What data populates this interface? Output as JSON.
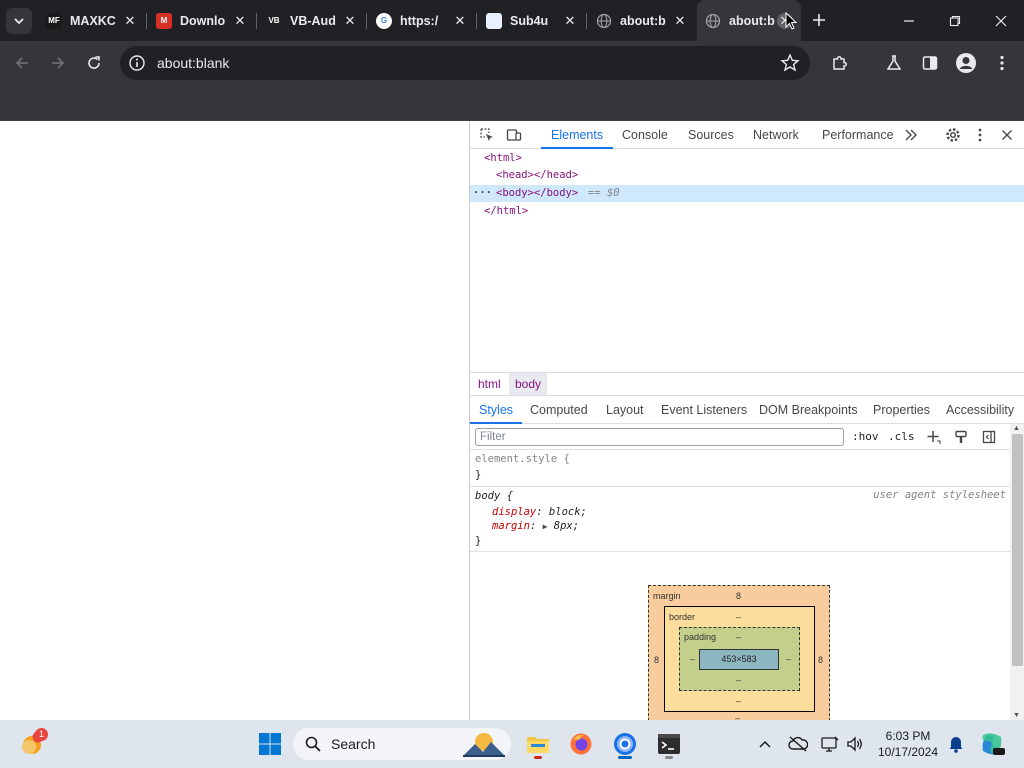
{
  "tabs": [
    {
      "title": "MAXKC",
      "favicon_text": "MF",
      "favicon_bg": "#1a1a1a",
      "favicon_fg": "#ffffff"
    },
    {
      "title": "Downlo",
      "favicon_text": "M",
      "favicon_bg": "#d93025",
      "favicon_fg": "#ffffff"
    },
    {
      "title": "VB-Aud",
      "favicon_text": "VB",
      "favicon_bg": "#202124",
      "favicon_fg": "#ffffff"
    },
    {
      "title": "https:/",
      "favicon_text": "G",
      "favicon_bg": "#ffffff",
      "favicon_fg": "#4285f4"
    },
    {
      "title": "Sub4u",
      "favicon_text": "",
      "favicon_bg": "#e8f0fe",
      "favicon_fg": "#1a73e8"
    },
    {
      "title": "about:b",
      "favicon_text": "",
      "favicon_bg": "",
      "favicon_fg": ""
    },
    {
      "title": "about:b",
      "favicon_text": "",
      "favicon_bg": "",
      "favicon_fg": ""
    }
  ],
  "omnibox": {
    "url": "about:blank"
  },
  "devtools": {
    "tabs": [
      "Elements",
      "Console",
      "Sources",
      "Network",
      "Performance"
    ],
    "active_tab": "Elements",
    "dom": {
      "html_open": "<html>",
      "head": "<head></head>",
      "body": "<body></body>",
      "body_eq": "== $0",
      "html_close": "</html>",
      "ellipsis": "···"
    },
    "breadcrumbs": [
      "html",
      "body"
    ],
    "sub_tabs": [
      "Styles",
      "Computed",
      "Layout",
      "Event Listeners",
      "DOM Breakpoints",
      "Properties",
      "Accessibility"
    ],
    "filter_placeholder": "Filter",
    "hov": ":hov",
    "cls": ".cls",
    "styles": {
      "element_style_selector": "element.style {",
      "close_brace": "}",
      "body_selector": "body {",
      "body_source": "user agent stylesheet",
      "prop_display": "display",
      "val_display": "block;",
      "prop_margin": "margin",
      "val_margin": "8px;"
    },
    "box_model": {
      "margin_label": "margin",
      "margin_top": "8",
      "margin_left": "8",
      "margin_right": "8",
      "margin_bottom": "–",
      "border_label": "border",
      "border_top": "–",
      "border_bottom": "–",
      "padding_label": "padding",
      "padding_top": "–",
      "padding_left": "–",
      "padding_right": "–",
      "padding_bottom": "–",
      "content_left": "–",
      "content_right": "–",
      "content": "453×583"
    }
  },
  "taskbar": {
    "search_label": "Search",
    "weather_badge": "1",
    "time": "6:03 PM",
    "date": "10/17/2024"
  }
}
